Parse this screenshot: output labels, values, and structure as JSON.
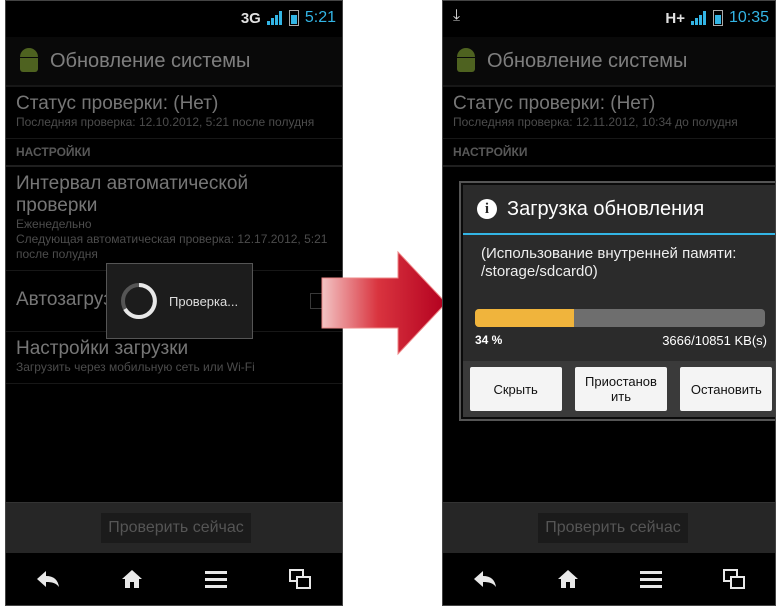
{
  "left": {
    "status_time": "5:21",
    "network": "3G",
    "app_title": "Обновление системы",
    "check_status_title": "Статус проверки: (Нет)",
    "check_status_sub": "Последняя проверка: 12.10.2012, 5:21 после полудня",
    "category": "НАСТРОЙКИ",
    "interval_title": "Интервал автоматической проверки",
    "interval_sub": "Еженедельно\nСледующая автоматическая проверка: 12.17.2012, 5:21 после полудня",
    "autoload_title": "Автозагруз",
    "download_settings_title": "Настройки загрузки",
    "download_settings_sub": "Загрузить через мобильную сеть или Wi-Fi",
    "progress_text": "Проверка...",
    "check_now": "Проверить сейчас"
  },
  "right": {
    "status_time": "10:35",
    "network": "H+",
    "app_title": "Обновление системы",
    "check_status_title": "Статус проверки: (Нет)",
    "check_status_sub": "Последняя проверка: 12.11.2012, 10:34 до полудня",
    "category": "НАСТРОЙКИ",
    "dialog_title": "Загрузка обновления",
    "dialog_message": "(Использование внутренней памяти: /storage/sdcard0)",
    "progress_percent": "34 %",
    "progress_fraction": 0.34,
    "progress_kb": "3666/10851 KB(s)",
    "btn_hide": "Скрыть",
    "btn_pause": "Приостанов ить",
    "btn_stop": "Остановить",
    "check_now": "Проверить сейчас"
  },
  "colors": {
    "accent": "#33b5e5",
    "progress": "#f0b43c",
    "arrow": "#c8102e"
  },
  "icons": [
    "back-icon",
    "home-icon",
    "menu-icon",
    "recent-apps-icon",
    "info-icon",
    "android-icon",
    "download-icon"
  ]
}
